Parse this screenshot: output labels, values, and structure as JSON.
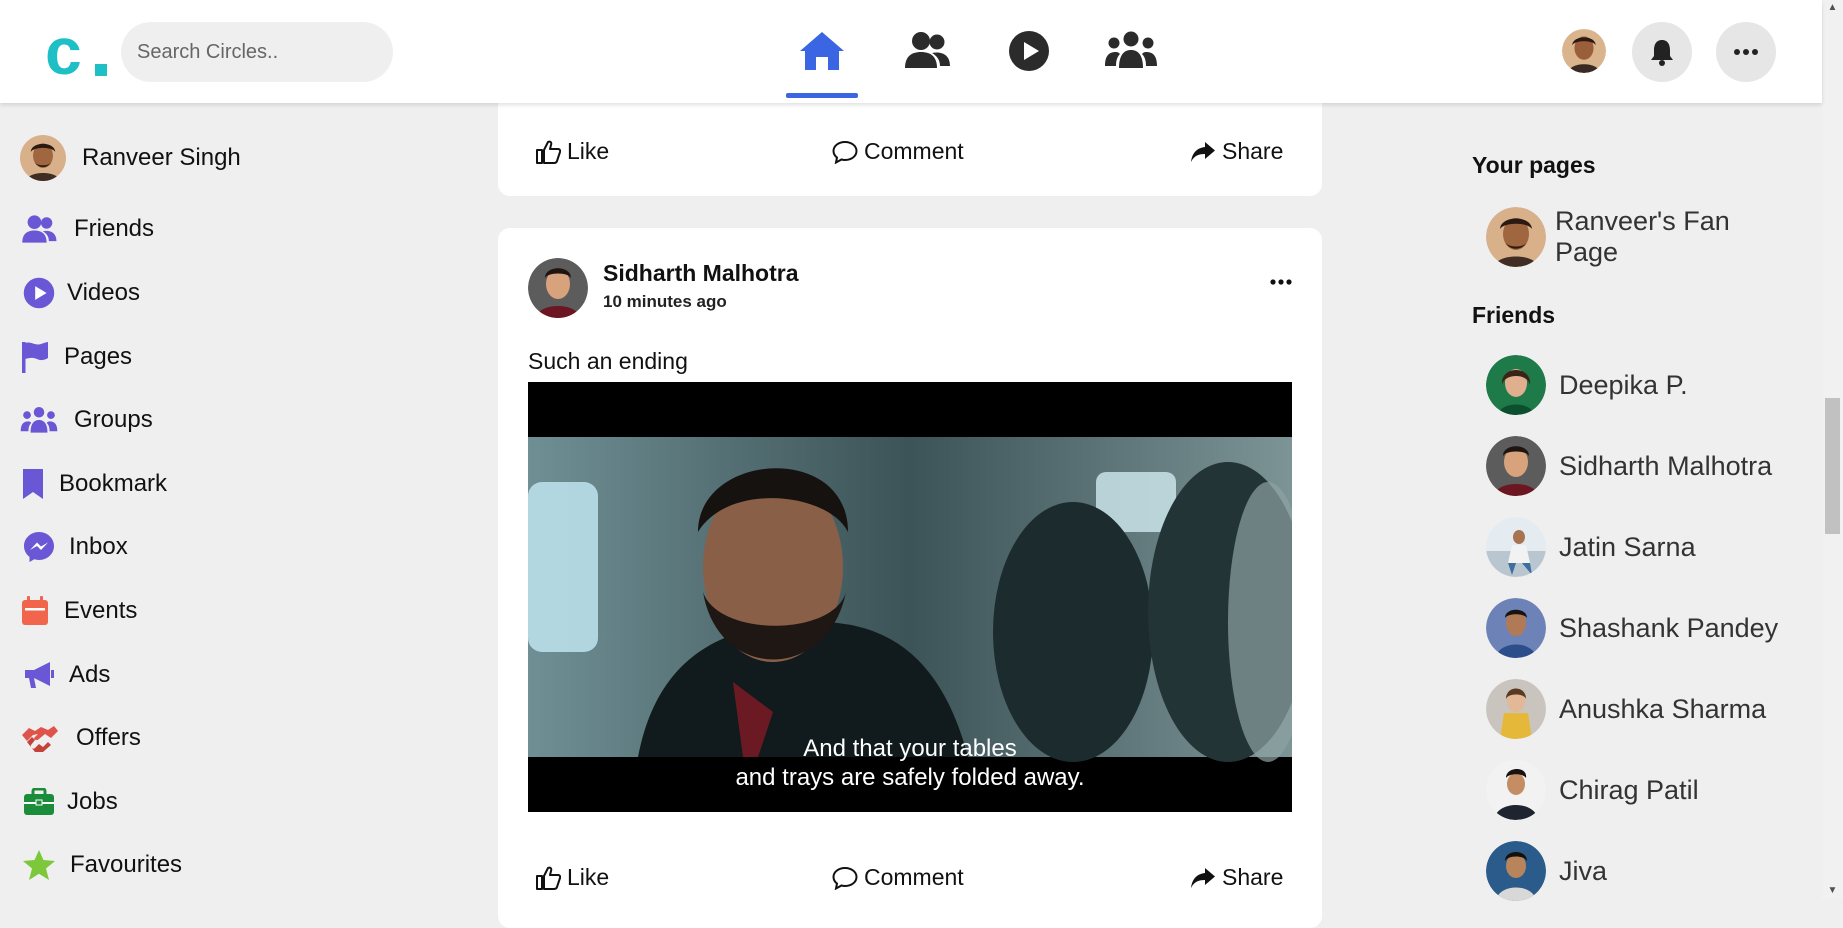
{
  "header": {
    "logo_text": "c.",
    "search_placeholder": "Search Circles..",
    "nav": [
      "home-icon",
      "friends-icon",
      "video-play-icon",
      "groups-icon"
    ],
    "active_nav": "home-icon",
    "accent_color": "#3a66e3",
    "logo_color": "#1fbfc6"
  },
  "user": {
    "name": "Ranveer Singh"
  },
  "sidebar": {
    "items": [
      {
        "label": "Friends",
        "icon": "friends-icon"
      },
      {
        "label": "Videos",
        "icon": "video-play-icon"
      },
      {
        "label": "Pages",
        "icon": "flag-icon"
      },
      {
        "label": "Groups",
        "icon": "groups-icon"
      },
      {
        "label": "Bookmark",
        "icon": "bookmark-icon"
      },
      {
        "label": "Inbox",
        "icon": "messenger-icon"
      },
      {
        "label": "Events",
        "icon": "calendar-icon"
      },
      {
        "label": "Ads",
        "icon": "megaphone-icon"
      },
      {
        "label": "Offers",
        "icon": "handshake-icon"
      },
      {
        "label": "Jobs",
        "icon": "briefcase-icon"
      },
      {
        "label": "Favourites",
        "icon": "star-icon"
      }
    ]
  },
  "actions": {
    "like": "Like",
    "comment": "Comment",
    "share": "Share"
  },
  "post": {
    "author": "Sidharth Malhotra",
    "time": "10 minutes ago",
    "text": "Such an ending",
    "subtitle_line1": "And that your tables",
    "subtitle_line2": "and trays are safely folded away."
  },
  "right": {
    "pages_heading": "Your pages",
    "page_name": "Ranveer's Fan Page",
    "friends_heading": "Friends",
    "friends": [
      "Deepika P.",
      "Sidharth Malhotra",
      "Jatin Sarna",
      "Shashank Pandey",
      "Anushka Sharma",
      "Chirag Patil",
      "Jiva"
    ]
  }
}
